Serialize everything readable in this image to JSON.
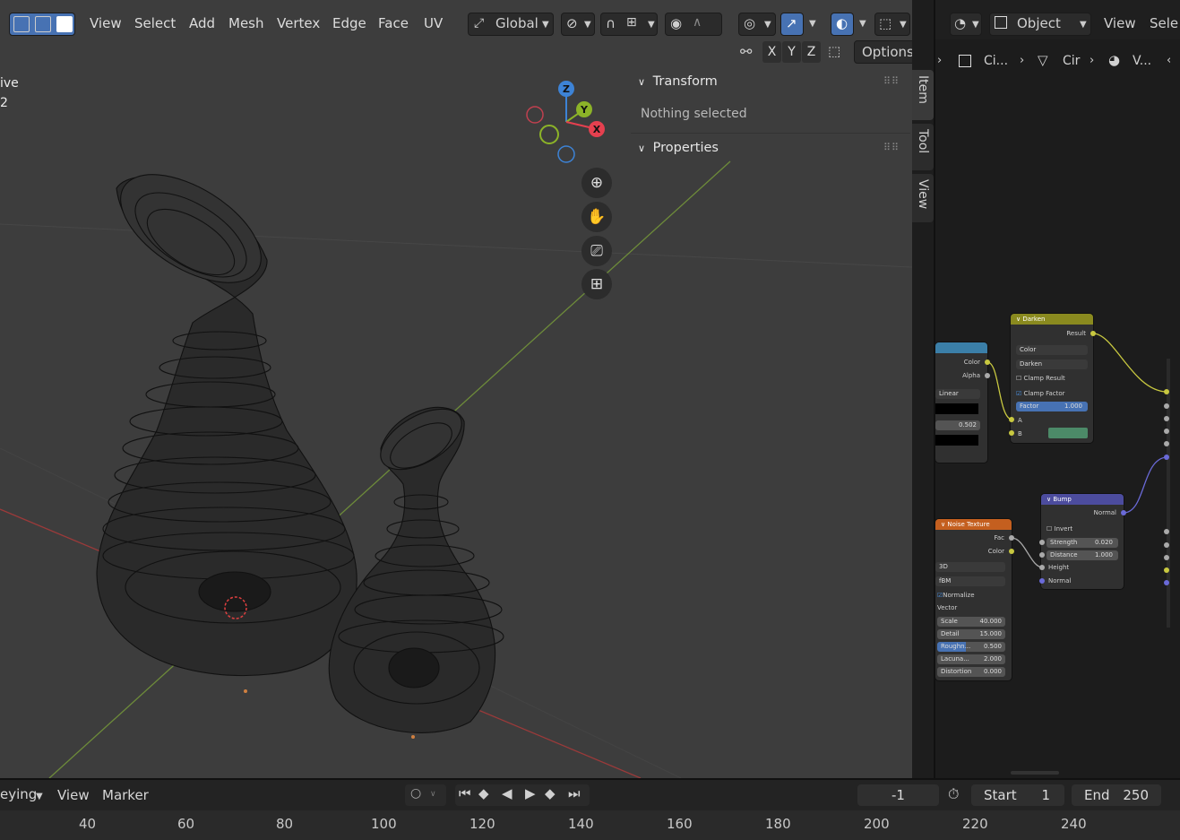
{
  "viewport_header": {
    "menus": [
      "View",
      "Select",
      "Add",
      "Mesh",
      "Vertex",
      "Edge",
      "Face",
      "UV"
    ],
    "orientation": "Global",
    "axes": [
      "X",
      "Y",
      "Z"
    ],
    "options_label": "Options"
  },
  "viewport_overlay_text": {
    "line1": "ive",
    "line2": "2"
  },
  "npanel": {
    "transform_label": "Transform",
    "nothing_selected": "Nothing selected",
    "properties_label": "Properties"
  },
  "sidebar_tabs": [
    "Item",
    "Tool",
    "View"
  ],
  "gizmo": {
    "z": "Z",
    "y": "Y",
    "x": "X"
  },
  "right_header": {
    "mode": "Object",
    "view": "View",
    "select": "Sele",
    "breadcrumbs": [
      "Ci...",
      "Cir",
      "V..."
    ]
  },
  "nodes": {
    "darken": {
      "title": "Darken",
      "result": "Result",
      "data_type": "Color",
      "blend": "Darken",
      "clamp_result": "Clamp Result",
      "clamp_factor": "Clamp Factor",
      "factor_label": "Factor",
      "factor_value": "1.000",
      "a": "A",
      "b": "B"
    },
    "ramp": {
      "color": "Color",
      "alpha": "Alpha",
      "interp": "Linear",
      "pos": "0.502"
    },
    "bump": {
      "title": "Bump",
      "normal_out": "Normal",
      "invert": "Invert",
      "strength_label": "Strength",
      "strength_value": "0.020",
      "distance_label": "Distance",
      "distance_value": "1.000",
      "height": "Height",
      "normal_in": "Normal"
    },
    "noise": {
      "title": "Noise Texture",
      "fac": "Fac",
      "color": "Color",
      "dim": "3D",
      "type": "fBM",
      "normalize": "Normalize",
      "vector": "Vector",
      "params": [
        {
          "label": "Scale",
          "value": "40.000"
        },
        {
          "label": "Detail",
          "value": "15.000"
        },
        {
          "label": "Roughn...",
          "value": "0.500"
        },
        {
          "label": "Lacuna...",
          "value": "2.000"
        },
        {
          "label": "Distortion",
          "value": "0.000"
        }
      ]
    }
  },
  "timeline": {
    "keying": "eying",
    "view": "View",
    "marker": "Marker",
    "current_frame": "-1",
    "start_label": "Start",
    "start_value": "1",
    "end_label": "End",
    "end_value": "250",
    "ticks": [
      "40",
      "60",
      "80",
      "100",
      "120",
      "140",
      "160",
      "180",
      "200",
      "220",
      "240"
    ]
  },
  "colors": {
    "accent": "#4772b3",
    "gizmo_x": "#e5404f",
    "gizmo_y": "#8cb328",
    "gizmo_z": "#3d83d6",
    "darken_header": "#8a8a1f",
    "bump_header": "#4c4c9e",
    "noise_header": "#c45f1f"
  }
}
